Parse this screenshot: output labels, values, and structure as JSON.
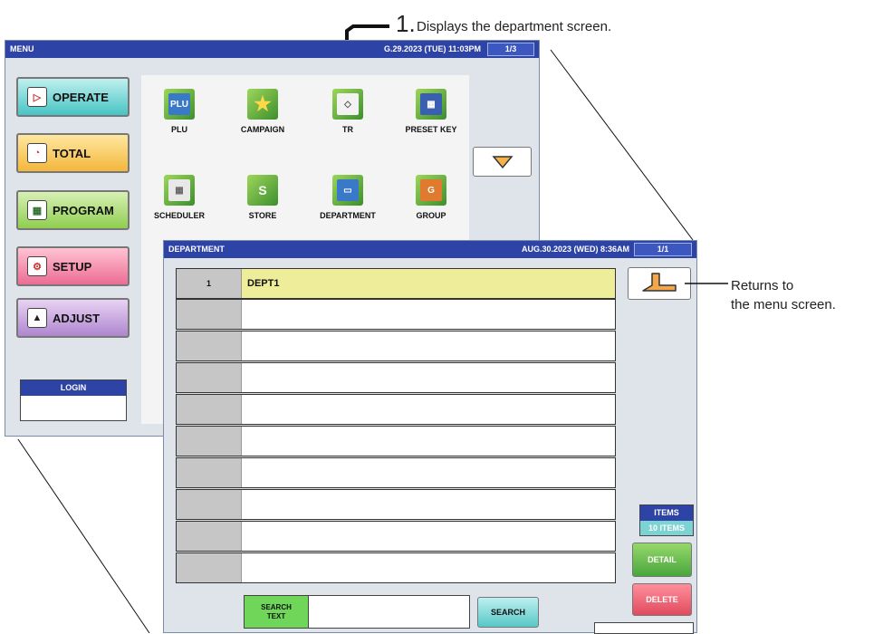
{
  "callouts": {
    "step_number": "1.",
    "step_text": "Displays the department screen.",
    "return_line1": "Returns to",
    "return_line2": "the menu screen."
  },
  "menu": {
    "title": "MENU",
    "datetime": "G.29.2023 (TUE) 11:03PM",
    "page": "1/3",
    "side_buttons": [
      {
        "label": "OPERATE",
        "icon": "play-icon"
      },
      {
        "label": "TOTAL",
        "icon": "clock-icon"
      },
      {
        "label": "PROGRAM",
        "icon": "book-icon"
      },
      {
        "label": "SETUP",
        "icon": "wrench-icon"
      },
      {
        "label": "ADJUST",
        "icon": "adjust-icon"
      }
    ],
    "login_label": "LOGIN",
    "items": [
      {
        "label": "PLU",
        "icon": "plu-icon"
      },
      {
        "label": "CAMPAIGN",
        "icon": "star-icon"
      },
      {
        "label": "TR",
        "icon": "tray-icon"
      },
      {
        "label": "PRESET KEY",
        "icon": "keyboard-icon"
      },
      {
        "label": "SCHEDULER",
        "icon": "calendar-icon"
      },
      {
        "label": "STORE",
        "icon": "store-icon"
      },
      {
        "label": "DEPARTMENT",
        "icon": "folder-icon"
      },
      {
        "label": "GROUP",
        "icon": "group-icon"
      }
    ]
  },
  "department": {
    "title": "DEPARTMENT",
    "datetime": "AUG.30.2023 (WED)  8:36AM",
    "page": "1/1",
    "rows": [
      {
        "num": "1",
        "name": "DEPT1"
      },
      {
        "num": "",
        "name": ""
      },
      {
        "num": "",
        "name": ""
      },
      {
        "num": "",
        "name": ""
      },
      {
        "num": "",
        "name": ""
      },
      {
        "num": "",
        "name": ""
      },
      {
        "num": "",
        "name": ""
      },
      {
        "num": "",
        "name": ""
      },
      {
        "num": "",
        "name": ""
      },
      {
        "num": "",
        "name": ""
      }
    ],
    "items_label": "ITEMS",
    "items_count": "10 ITEMS",
    "detail_label": "DETAIL",
    "delete_label": "DELETE",
    "search_label": "SEARCH\nTEXT",
    "search_value": "",
    "search_button": "SEARCH"
  },
  "colors": {
    "titlebar": "#2e43a6",
    "selected_row": "#eded9a",
    "detail": "#4aa63e",
    "delete": "#e04b5e"
  }
}
